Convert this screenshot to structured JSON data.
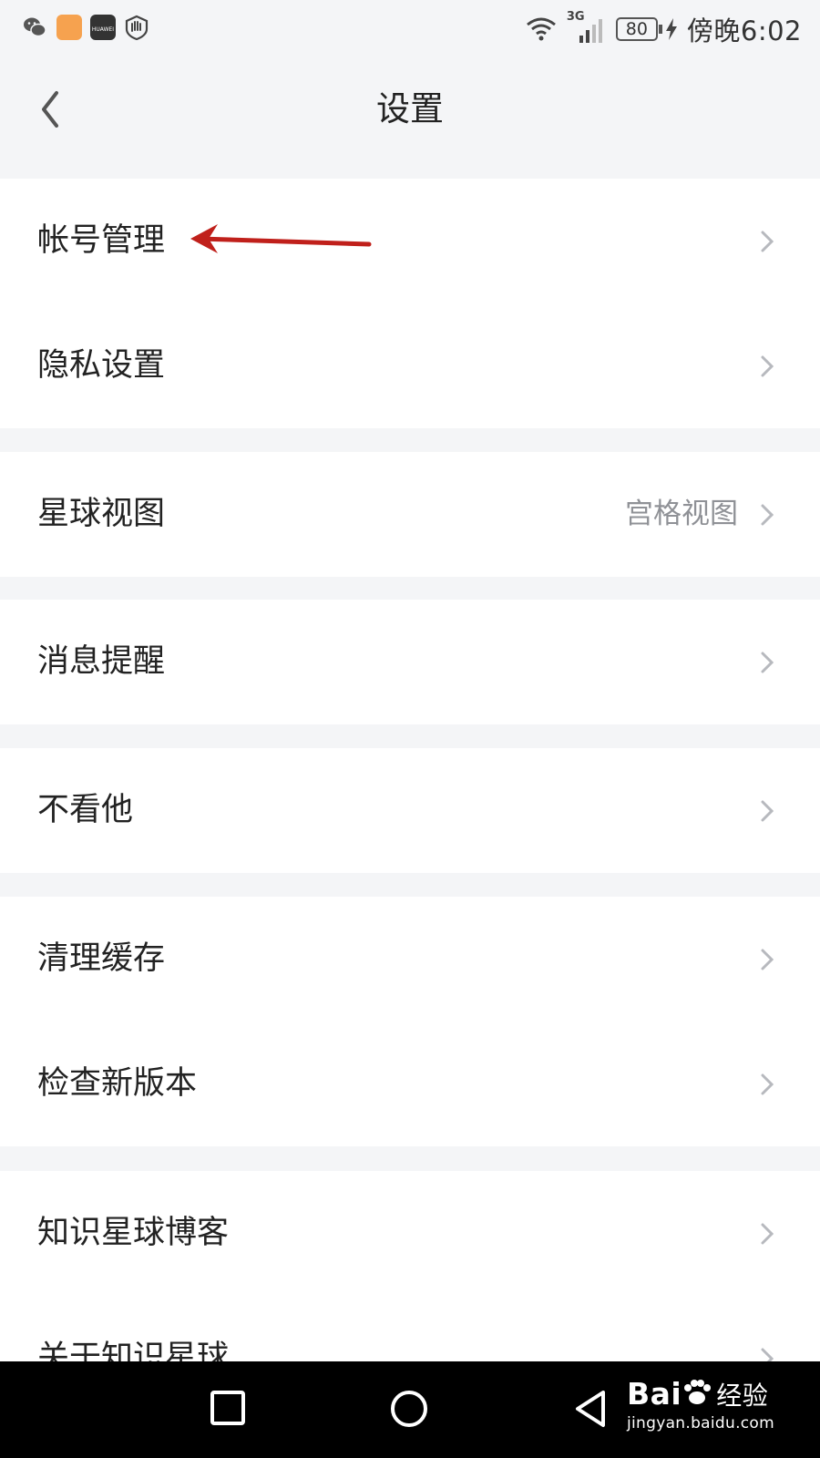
{
  "status_bar": {
    "time": "傍晚6:02",
    "battery": "80",
    "network": "3G",
    "left_icons": [
      "wechat-icon",
      "note-app-icon",
      "huawei-store-icon",
      "hand-shield-icon"
    ],
    "store_text": "HUAWEI"
  },
  "header": {
    "title": "设置",
    "back_icon": "chevron-left-icon"
  },
  "sections": [
    {
      "items": [
        {
          "label": "帐号管理",
          "value": ""
        },
        {
          "label": "隐私设置",
          "value": ""
        }
      ]
    },
    {
      "items": [
        {
          "label": "星球视图",
          "value": "宫格视图"
        }
      ]
    },
    {
      "items": [
        {
          "label": "消息提醒",
          "value": ""
        }
      ]
    },
    {
      "items": [
        {
          "label": "不看他",
          "value": ""
        }
      ]
    },
    {
      "items": [
        {
          "label": "清理缓存",
          "value": ""
        },
        {
          "label": "检查新版本",
          "value": ""
        }
      ]
    },
    {
      "items": [
        {
          "label": "知识星球博客",
          "value": ""
        },
        {
          "label": "关于知识星球",
          "value": ""
        }
      ]
    }
  ],
  "annotation": {
    "color": "#c0201b",
    "target": "帐号管理"
  },
  "nav_bar": {
    "buttons": [
      "recents-square-icon",
      "home-circle-icon",
      "back-triangle-icon"
    ]
  },
  "watermark": {
    "brand": "Bai",
    "brand_suffix": "经验",
    "url": "jingyan.baidu.com"
  },
  "colors": {
    "background": "#f4f5f7",
    "card": "#ffffff",
    "text": "#222222",
    "secondary_text": "#8f9196",
    "chevron": "#b7b9be"
  }
}
